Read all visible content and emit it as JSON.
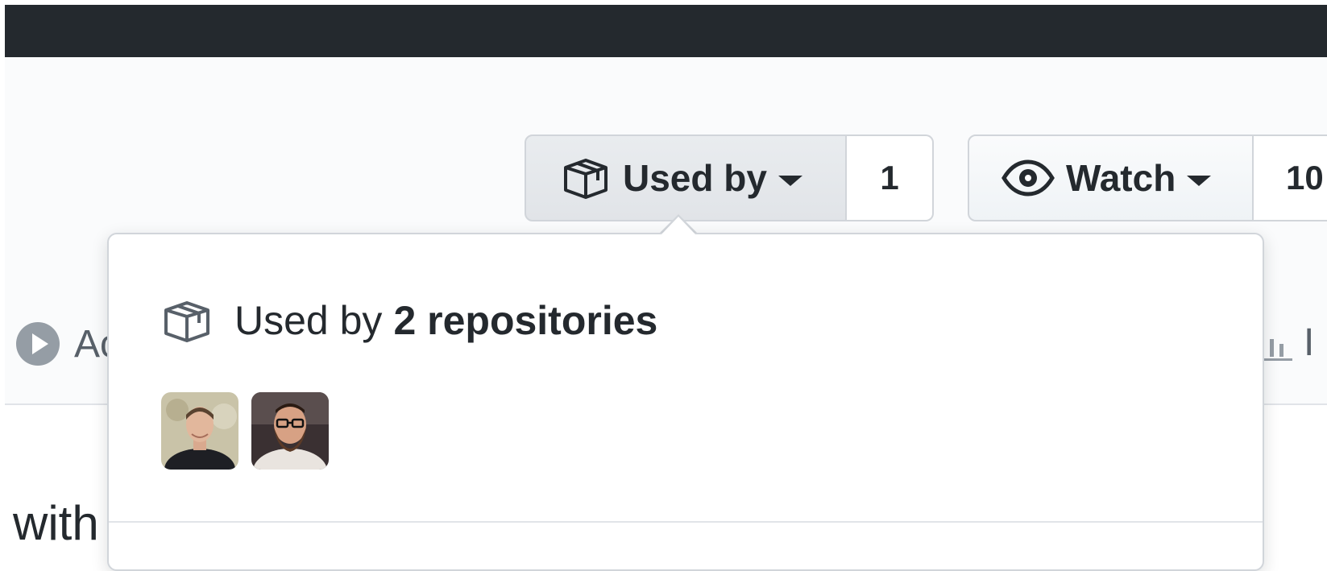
{
  "toolbar": {
    "used_by": {
      "label": "Used by",
      "count": "1",
      "icon": "package-icon"
    },
    "watch": {
      "label": "Watch",
      "count": "10",
      "icon": "eye-icon"
    }
  },
  "nav": {
    "left_partial": "Ac",
    "right_partial": "I"
  },
  "body_text": {
    "partial": "with"
  },
  "popover": {
    "title_prefix": "Used by",
    "title_count": "2 repositories",
    "avatars": [
      {
        "name": "avatar"
      },
      {
        "name": "avatar"
      }
    ]
  },
  "colors": {
    "header_bg": "#24292e",
    "repohead_bg": "#fafbfc",
    "border": "#d1d5da",
    "text": "#24292e",
    "muted": "#586069"
  }
}
